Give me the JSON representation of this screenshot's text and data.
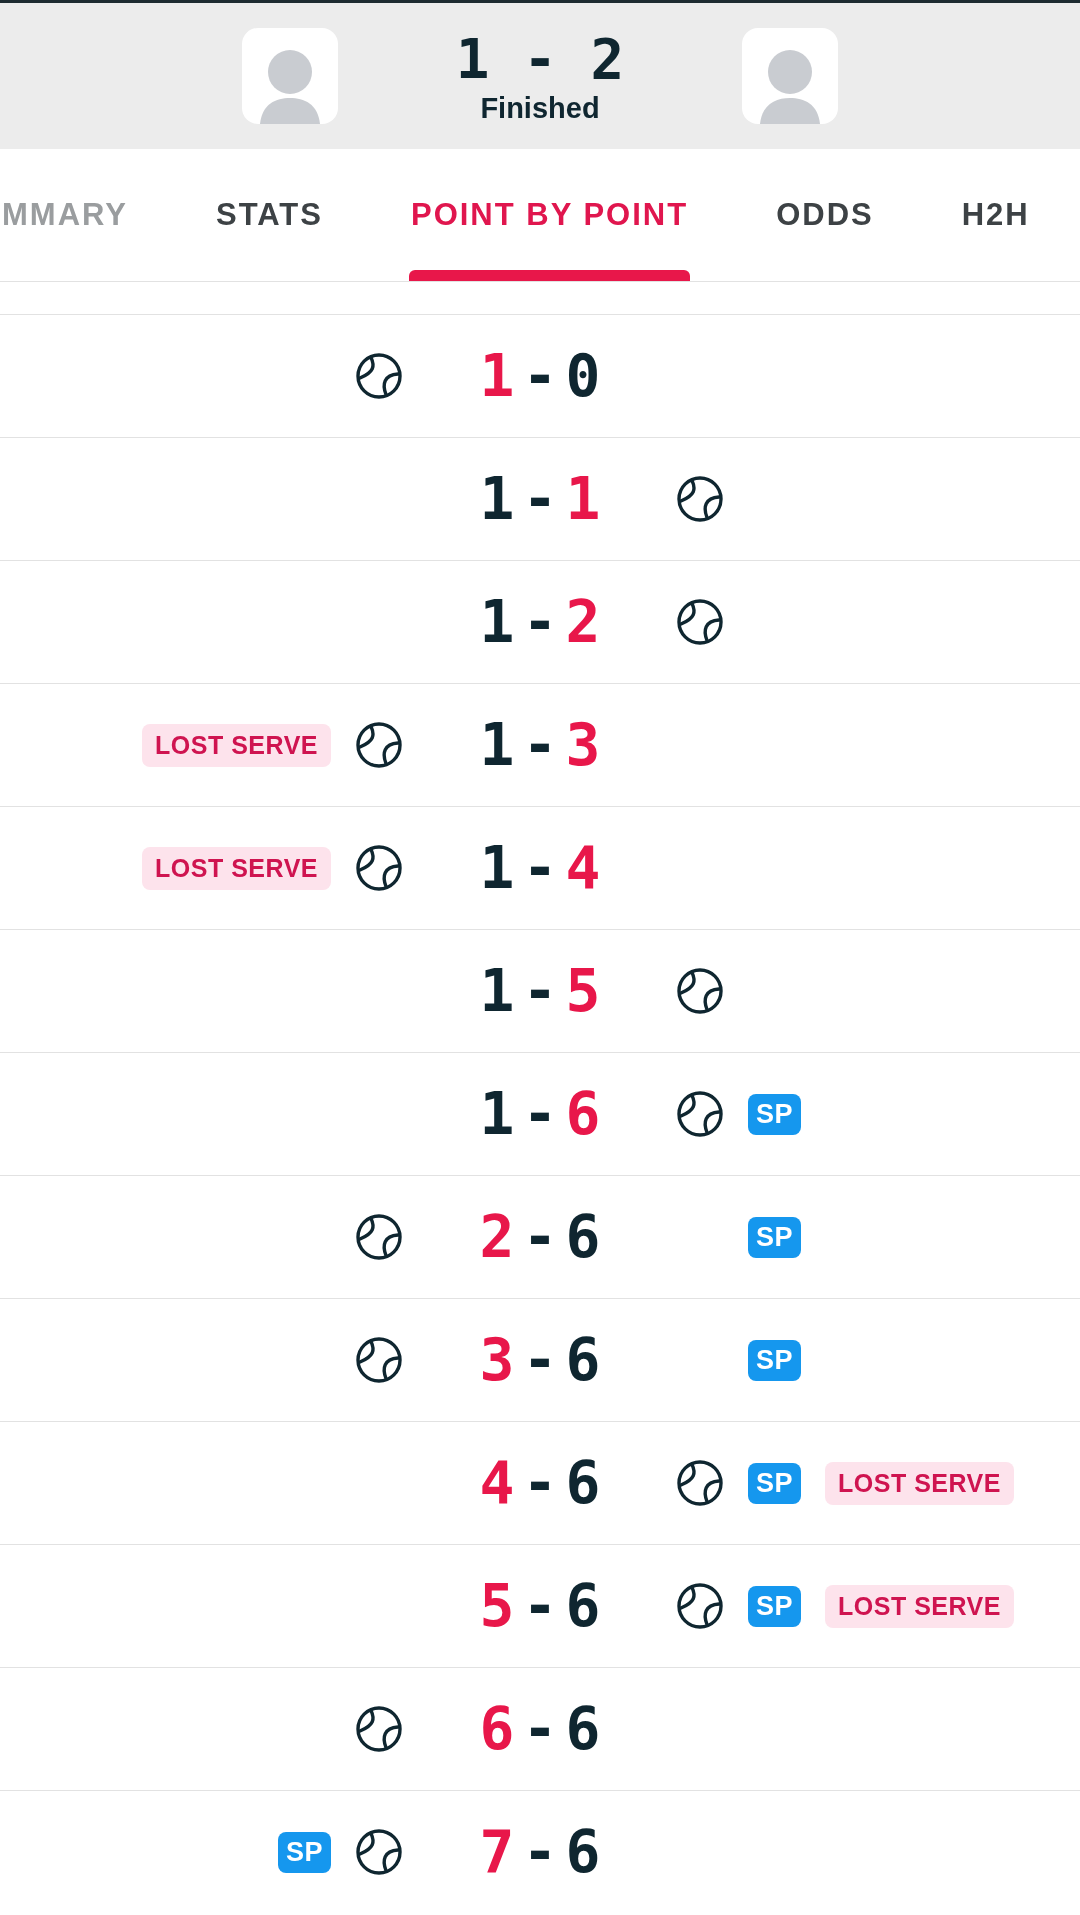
{
  "match": {
    "score": "1 - 2",
    "status": "Finished"
  },
  "tabs": [
    {
      "label": "MMARY",
      "selected": false,
      "faded": true
    },
    {
      "label": "STATS",
      "selected": false,
      "faded": false
    },
    {
      "label": "POINT BY POINT",
      "selected": true,
      "faded": false
    },
    {
      "label": "ODDS",
      "selected": false,
      "faded": false
    },
    {
      "label": "H2H",
      "selected": false,
      "faded": false
    }
  ],
  "rows": [
    {
      "score": [
        "1",
        "-",
        "0"
      ],
      "left_won": true,
      "left_serves": true,
      "left_badges": [],
      "right_badges": []
    },
    {
      "score": [
        "1",
        "-",
        "1"
      ],
      "left_won": false,
      "left_serves": false,
      "left_badges": [],
      "right_badges": []
    },
    {
      "score": [
        "1",
        "-",
        "2"
      ],
      "left_won": false,
      "left_serves": false,
      "left_badges": [],
      "right_badges": []
    },
    {
      "score": [
        "1",
        "-",
        "3"
      ],
      "left_won": false,
      "left_serves": true,
      "left_badges": [
        {
          "kind": "lost_serve",
          "text": "LOST SERVE"
        }
      ],
      "right_badges": []
    },
    {
      "score": [
        "1",
        "-",
        "4"
      ],
      "left_won": false,
      "left_serves": true,
      "left_badges": [
        {
          "kind": "lost_serve",
          "text": "LOST SERVE"
        }
      ],
      "right_badges": []
    },
    {
      "score": [
        "1",
        "-",
        "5"
      ],
      "left_won": false,
      "left_serves": false,
      "left_badges": [],
      "right_badges": []
    },
    {
      "score": [
        "1",
        "-",
        "6"
      ],
      "left_won": false,
      "left_serves": false,
      "left_badges": [],
      "right_badges": [
        {
          "kind": "set_point",
          "text": "SP"
        }
      ]
    },
    {
      "score": [
        "2",
        "-",
        "6"
      ],
      "left_won": true,
      "left_serves": true,
      "left_badges": [],
      "right_badges": [
        {
          "kind": "set_point",
          "text": "SP"
        }
      ]
    },
    {
      "score": [
        "3",
        "-",
        "6"
      ],
      "left_won": true,
      "left_serves": true,
      "left_badges": [],
      "right_badges": [
        {
          "kind": "set_point",
          "text": "SP"
        }
      ]
    },
    {
      "score": [
        "4",
        "-",
        "6"
      ],
      "left_won": true,
      "left_serves": false,
      "left_badges": [],
      "right_badges": [
        {
          "kind": "set_point",
          "text": "SP"
        },
        {
          "kind": "lost_serve",
          "text": "LOST SERVE"
        }
      ]
    },
    {
      "score": [
        "5",
        "-",
        "6"
      ],
      "left_won": true,
      "left_serves": false,
      "left_badges": [],
      "right_badges": [
        {
          "kind": "set_point",
          "text": "SP"
        },
        {
          "kind": "lost_serve",
          "text": "LOST SERVE"
        }
      ]
    },
    {
      "score": [
        "6",
        "-",
        "6"
      ],
      "left_won": true,
      "left_serves": true,
      "left_badges": [],
      "right_badges": []
    },
    {
      "score": [
        "7",
        "-",
        "6"
      ],
      "left_won": true,
      "left_serves": true,
      "left_badges": [
        {
          "kind": "set_point",
          "text": "SP"
        }
      ],
      "right_badges": []
    }
  ]
}
